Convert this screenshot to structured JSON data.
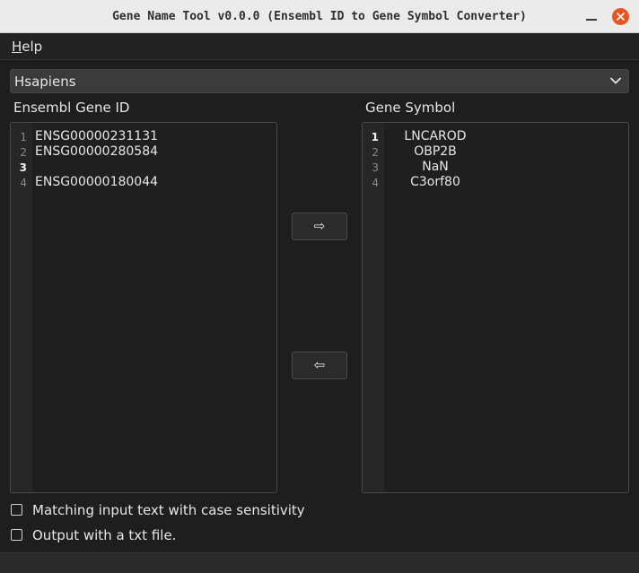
{
  "window": {
    "title": "Gene Name Tool v0.0.0 (Ensembl ID to Gene Symbol Converter)"
  },
  "menu": {
    "help_prefix": "H",
    "help_rest": "elp"
  },
  "species_select": {
    "selected": "Hsapiens"
  },
  "left_panel": {
    "label": "Ensembl Gene ID",
    "line_numbers": [
      "1",
      "2",
      "3",
      "4"
    ],
    "active_line": 3,
    "lines": [
      "ENSG00000231131",
      "ENSG00000280584",
      "",
      "ENSG00000180044"
    ]
  },
  "right_panel": {
    "label": "Gene Symbol",
    "line_numbers": [
      "1",
      "2",
      "3",
      "4"
    ],
    "active_line": 1,
    "lines": [
      "LNCAROD",
      "OBP2B",
      "NaN",
      "C3orf80"
    ]
  },
  "buttons": {
    "convert_right": "⇨",
    "convert_left": "⇦"
  },
  "options": {
    "case_sensitive_label": "Matching input text with case sensitivity",
    "case_sensitive_checked": false,
    "txt_output_label": "Output with a txt file.",
    "txt_output_checked": false
  },
  "colors": {
    "close_button": "#e95420",
    "background": "#1e1e1e",
    "titlebar": "#ebebeb"
  }
}
